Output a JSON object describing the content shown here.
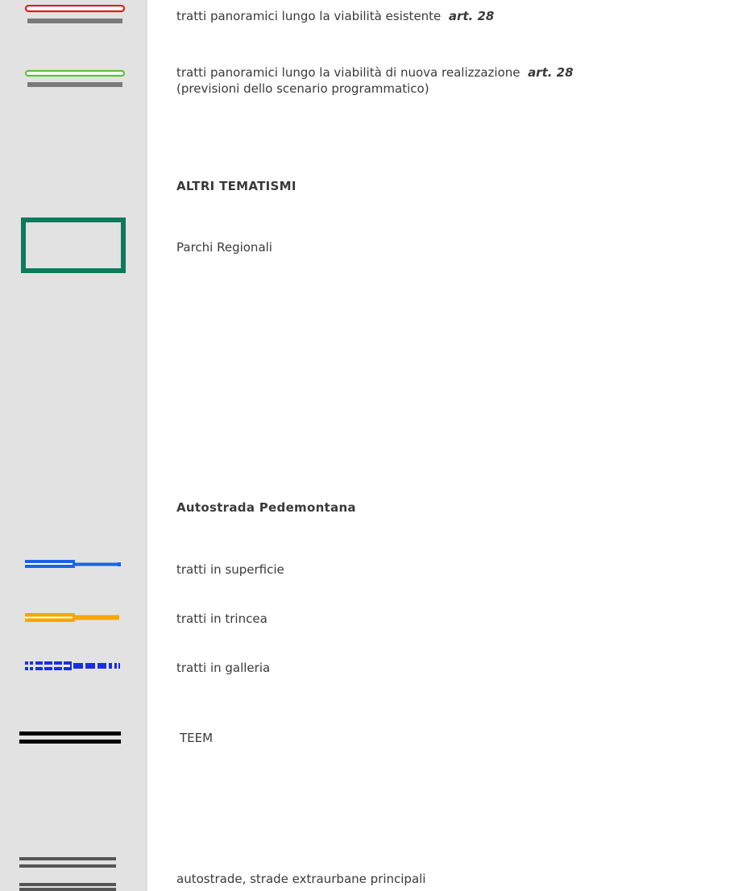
{
  "legend": {
    "panoramic_existing": {
      "label": "tratti panoramici lungo la viabilità esistente",
      "ref": "art. 28",
      "colors": {
        "accent": "#e01b1b",
        "road": "#7a7a7a"
      }
    },
    "panoramic_new": {
      "label": "tratti panoramici lungo la viabilità di nuova realizzazione",
      "ref": "art. 28",
      "sub": "(previsioni dello scenario programmatico)",
      "colors": {
        "accent": "#5cc13a",
        "road": "#7a7a7a"
      }
    },
    "altri_tematismi": {
      "heading": "ALTRI TEMATISMI"
    },
    "parchi_regionali": {
      "label": "Parchi Regionali",
      "colors": {
        "border": "#0d7a5a"
      }
    },
    "pedemontana": {
      "heading": "Autostrada Pedemontana",
      "items": [
        {
          "label": "tratti in superficie",
          "color": "#1b63e6",
          "style": "solid"
        },
        {
          "label": "tratti in trincea",
          "color": "#f5a800",
          "style": "solid"
        },
        {
          "label": "tratti in galleria",
          "color": "#1a2ee8",
          "style": "dashed"
        }
      ]
    },
    "teem": {
      "label": "TEEM",
      "colors": {
        "line": "#000000"
      }
    },
    "autostrade": {
      "label": "autostrade, strade extraurbane principali",
      "colors": {
        "line": "#555555"
      }
    }
  }
}
